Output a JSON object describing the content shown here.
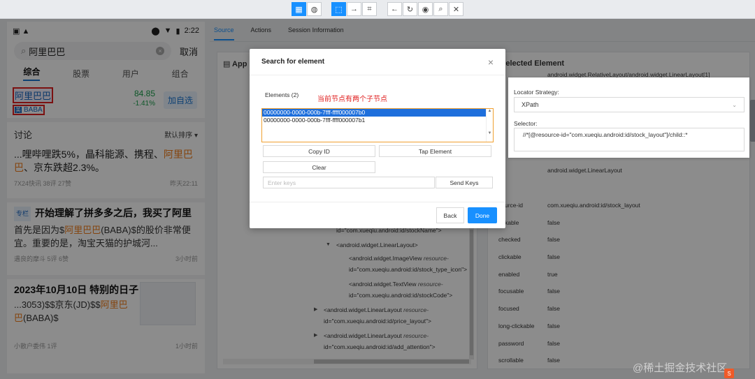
{
  "phone": {
    "time": "2:22",
    "search_query": "阿里巴巴",
    "cancel_label": "取消",
    "tabs": [
      "综合",
      "股票",
      "用户",
      "组合"
    ],
    "stock": {
      "name": "阿里巴巴",
      "code": "BABA",
      "code_tag": "美",
      "price": "84.85",
      "change": "-1.41%",
      "add_label": "加自选"
    },
    "discuss_label": "讨论",
    "sort_label": "默认排序",
    "posts": [
      {
        "title": "...哩哔哩跌5%，晶科能源、携程、",
        "title_hl": "阿里巴巴",
        "title_tail": "、京东跌超2.3%。",
        "meta_left": "7X24快讯 38评 27赞",
        "meta_time": "昨天22:11"
      },
      {
        "tag": "专栏",
        "title": "开始理解了拼多多之后，我买了阿里",
        "body_pre": "首先是因为$",
        "body_hl": "阿里巴巴",
        "body_post": "(BABA)$的股价非常便宜。重要的是，淘宝天猫的护城河...",
        "meta_left": "遇良的摩斗 5评 6赞",
        "meta_time": "3小时前"
      },
      {
        "title": "2023年10月10日 特别的日子",
        "body_pre": "...3053)$$京东(JD)$$",
        "body_hl": "阿里巴巴",
        "body_post": "(BABA)$",
        "meta_left": "小散户委伟 1评",
        "meta_time": "1小时前"
      }
    ]
  },
  "toolbar": {
    "icons": [
      "grid-icon",
      "globe-icon",
      "select-element-icon",
      "swipe-icon",
      "tap-coordinates-icon",
      "back-icon",
      "refresh-icon",
      "eye-icon",
      "search-icon",
      "close-icon"
    ]
  },
  "inspector": {
    "tabs": [
      "Source",
      "Actions",
      "Session Information"
    ],
    "source_title": "App So",
    "selected_title": "Selected Element",
    "tree": [
      {
        "text": "id=\"com.xueqiu.android:id/stockName\">"
      },
      {
        "text": "<android.widget.LinearLayout>"
      },
      {
        "text": "<android.widget.ImageView ",
        "attr": "resource-"
      },
      {
        "text": "id=\"com.xueqiu.android:id/stock_type_icon\">"
      },
      {
        "text": "<android.widget.TextView ",
        "attr": "resource-"
      },
      {
        "text": "id=\"com.xueqiu.android:id/stockCode\">"
      },
      {
        "text": "<android.widget.LinearLayout ",
        "attr": "resource-"
      },
      {
        "text": "id=\"com.xueqiu.android:id/price_layout\">"
      },
      {
        "text": "<android.widget.LinearLayout ",
        "attr": "resource-"
      },
      {
        "text": "id=\"com.xueqiu.android:id/add_attention\">"
      }
    ],
    "props_top": "android.widget.RelativeLayout/android.widget.LinearLayout[1]",
    "props": [
      {
        "k": "ss",
        "v": "android.widget.LinearLayout"
      },
      {
        "k": "t",
        "v": ""
      },
      {
        "k": "source-id",
        "v": "com.xueqiu.android:id/stock_layout"
      },
      {
        "k": "eckable",
        "v": "false"
      },
      {
        "k": "checked",
        "v": "false"
      },
      {
        "k": "clickable",
        "v": "false"
      },
      {
        "k": "enabled",
        "v": "true"
      },
      {
        "k": "focusable",
        "v": "false"
      },
      {
        "k": "focused",
        "v": "false"
      },
      {
        "k": "long-clickable",
        "v": "false"
      },
      {
        "k": "password",
        "v": "false"
      },
      {
        "k": "scrollable",
        "v": "false"
      }
    ]
  },
  "modal": {
    "title": "Search for element",
    "elements_label": "Elements (2)",
    "annotation": "当前节点有两个子节点",
    "elements": [
      "00000000-0000-000b-7fff-ffff000007b0",
      "00000000-0000-000b-7fff-ffff000007b1"
    ],
    "copy_id": "Copy ID",
    "tap_element": "Tap Element",
    "clear": "Clear",
    "keys_placeholder": "Enter keys",
    "send_keys": "Send Keys",
    "back": "Back",
    "done": "Done"
  },
  "locator": {
    "strategy_label": "Locator Strategy:",
    "strategy_value": "XPath",
    "selector_label": "Selector:",
    "selector_value": "//*[@resource-id=\"com.xueqiu.android:id/stock_layout\"]/child::*"
  },
  "watermark": "@稀土掘金技术社区"
}
